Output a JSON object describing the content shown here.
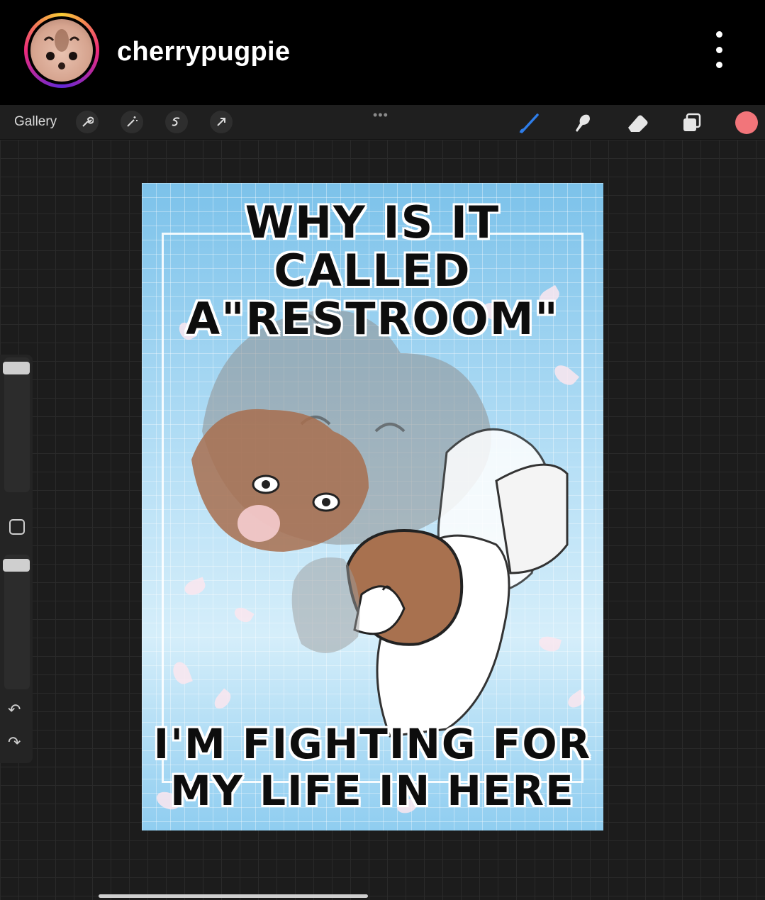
{
  "header": {
    "username": "cherrypugpie",
    "avatar_icon": "hamster-avatar-icon",
    "more_icon": "more-vertical-icon"
  },
  "toolbar": {
    "gallery_label": "Gallery",
    "left_tools": [
      "wrench-icon",
      "magic-wand-icon",
      "selection-icon",
      "transform-arrow-icon"
    ],
    "right_tools": [
      "brush-icon",
      "smudge-icon",
      "eraser-icon",
      "layers-icon"
    ],
    "color_swatch": "#f2757a",
    "brush_color": "#2e7de9"
  },
  "sidebar": {
    "undo_icon": "undo-icon",
    "redo_icon": "redo-icon",
    "modify_icon": "modify-square-icon"
  },
  "artwork": {
    "title_line1": "WHY IS IT CALLED",
    "title_line2": "A\"RESTROOM\"",
    "caption_line1": "I'M FIGHTING FOR",
    "caption_line2": "MY LIFE IN HERE",
    "background_color": "#a9d8f2"
  }
}
